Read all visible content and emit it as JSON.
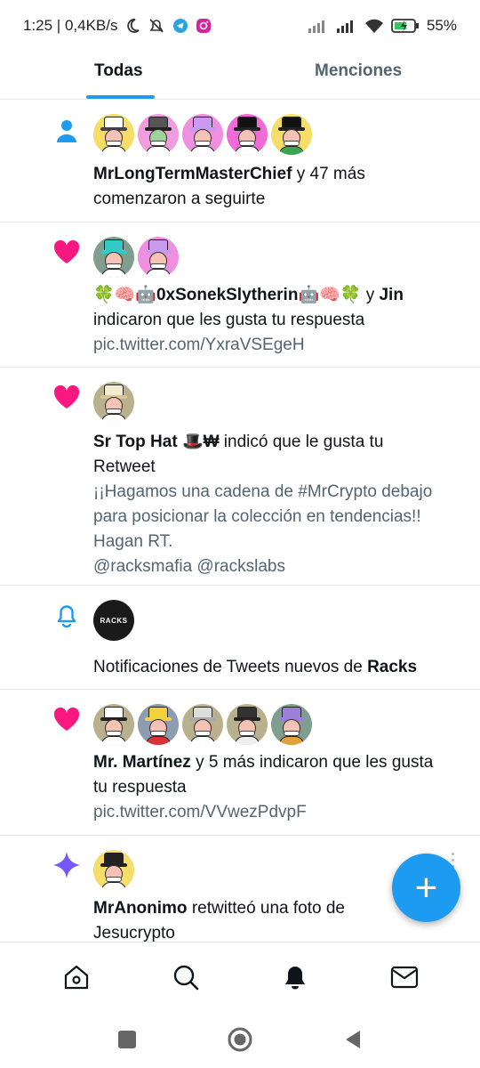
{
  "status_bar": {
    "time_and_speed": "1:25 | 0,4KB/s",
    "battery": "55%"
  },
  "tabs": [
    {
      "label": "Todas"
    },
    {
      "label": "Menciones"
    }
  ],
  "notifications": [
    {
      "kind_icon": "person-icon",
      "avatars": 5,
      "line1_bold": "MrLongTermMasterChief",
      "line1_rest": " y 47 más",
      "line2": "comenzaron a seguirte"
    },
    {
      "kind_icon": "heart-icon",
      "avatars": 2,
      "emoji_left": "🍀🧠🤖",
      "name_bold": "0xSonekSlytherin",
      "emoji_right": "🤖🧠🍀",
      "connector": " y ",
      "name2_bold": "Jin",
      "line2": "indicaron que les gusta tu respuesta",
      "link": " pic.twitter.com/YxraVSEgeH"
    },
    {
      "kind_icon": "heart-icon",
      "avatars": 1,
      "name_bold": "Sr Top Hat",
      "name_emoji": "🎩₩",
      "rest": " indicó que le gusta tu",
      "line2": "Retweet",
      "quote1": "¡¡Hagamos una cadena de #MrCrypto debajo",
      "quote2": "para posicionar la colección en tendencias!!",
      "quote3": "Hagan RT.",
      "quote4": "@racksmafia @rackslabs"
    },
    {
      "kind_icon": "bell-icon",
      "avatar_text": "RACKS",
      "text_plain": "Notificaciones de Tweets nuevos de ",
      "text_bold": "Racks"
    },
    {
      "kind_icon": "heart-icon",
      "avatars": 5,
      "name_bold": "Mr. Martínez",
      "rest": " y 5 más indicaron que les gusta",
      "line2": "tu respuesta",
      "link": " pic.twitter.com/VVwezPdvpF"
    },
    {
      "kind_icon": "sparkle-icon",
      "avatars": 1,
      "name_bold": "MrAnonimo",
      "rest": " retwitteó una foto de",
      "line2": "Jesucrypto"
    }
  ],
  "fab": {
    "label": "+"
  },
  "colors": {
    "accent": "#1d9bf0",
    "heart": "#f91880",
    "sparkle": "#7856ff",
    "text": "#0f1419",
    "secondary": "#536471"
  },
  "bottom_nav": [
    "home-icon",
    "search-icon",
    "bell-icon",
    "mail-icon"
  ]
}
